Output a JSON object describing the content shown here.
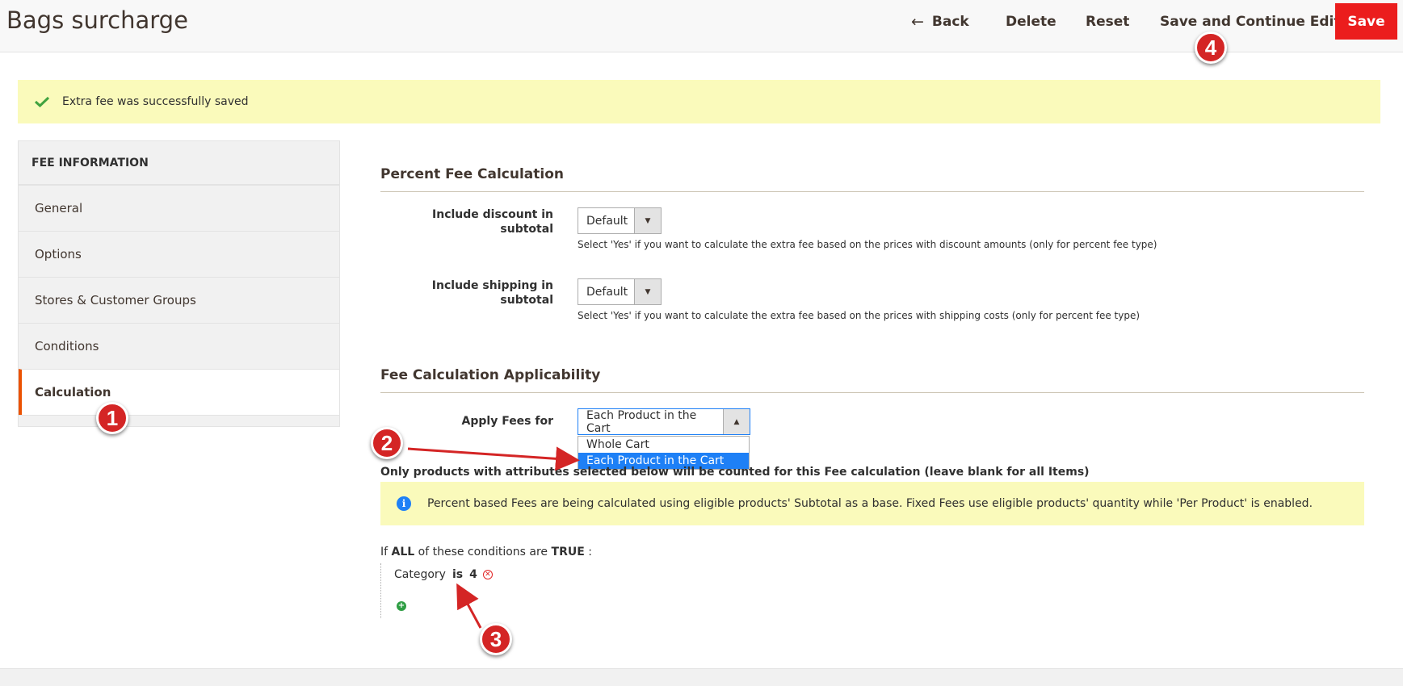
{
  "header": {
    "title": "Bags surcharge",
    "back_label": "Back",
    "delete_label": "Delete",
    "reset_label": "Reset",
    "save_continue_label": "Save and Continue Edit",
    "save_label": "Save"
  },
  "message": {
    "text": "Extra fee was successfully saved"
  },
  "sidebar": {
    "heading": "FEE INFORMATION",
    "items": [
      {
        "label": "General"
      },
      {
        "label": "Options"
      },
      {
        "label": "Stores & Customer Groups"
      },
      {
        "label": "Conditions"
      },
      {
        "label": "Calculation"
      }
    ]
  },
  "percent_section": {
    "title": "Percent Fee Calculation",
    "discount_label": "Include discount in subtotal",
    "discount_value": "Default",
    "discount_note": "Select 'Yes' if you want to calculate the extra fee based on the prices with discount amounts (only for percent fee type)",
    "shipping_label": "Include shipping in subtotal",
    "shipping_value": "Default",
    "shipping_note": "Select 'Yes' if you want to calculate the extra fee based on the prices with shipping costs (only for percent fee type)"
  },
  "applicability_section": {
    "title": "Fee Calculation Applicability",
    "apply_label": "Apply Fees for",
    "apply_value": "Each Product in the Cart",
    "options": [
      "Whole Cart",
      "Each Product in the Cart"
    ],
    "attributes_note": "Only products with attributes selected below will be counted for this Fee calculation (leave blank for all Items)",
    "info_text": "Percent based Fees are being calculated using eligible products' Subtotal as a base. Fixed Fees use eligible products' quantity while 'Per Product' is enabled."
  },
  "conditions": {
    "prefix": "If",
    "aggregator": "ALL",
    "middle": "of these conditions are",
    "value": "TRUE",
    "suffix": ":",
    "rule_attribute": "Category",
    "rule_operator": "is",
    "rule_value": "4"
  },
  "annotations": {
    "badge1": "1",
    "badge2": "2",
    "badge3": "3",
    "badge4": "4"
  },
  "colors": {
    "accent": "#eb5202",
    "save_button": "#eb1d1d",
    "message_bg": "#fafabb",
    "selected_option": "#1e80f6",
    "badge": "#d42525"
  }
}
